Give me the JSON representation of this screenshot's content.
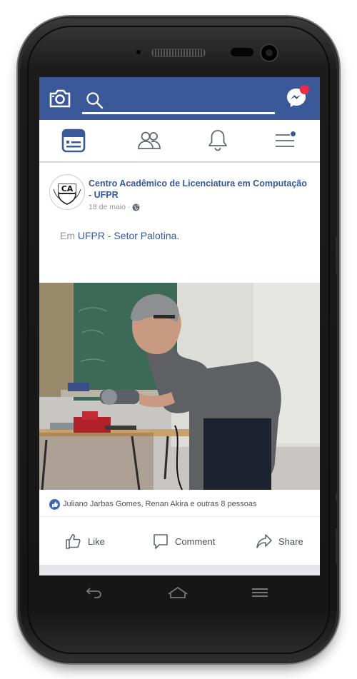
{
  "header": {
    "search_placeholder": ""
  },
  "post": {
    "page_name": "Centro Acadêmico de Licenciatura em Computação - UFPR",
    "date": "18 de maio",
    "text_prefix": "Em",
    "location": "UFPR - Setor Palotina.",
    "avatar_text": "CA",
    "likes_text": "Juliano Jarbas Gomes, Renan Akira e outras 8 pessoas"
  },
  "actions": {
    "like": "Like",
    "comment": "Comment",
    "share": "Share"
  },
  "colors": {
    "brand": "#3b5998",
    "link": "#365899",
    "badge": "#f02849"
  },
  "icons": [
    "camera-icon",
    "search-icon",
    "messenger-icon",
    "news-feed-icon",
    "friends-icon",
    "notifications-icon",
    "menu-icon",
    "globe-icon",
    "like-icon",
    "comment-icon",
    "share-icon",
    "back-icon",
    "home-icon",
    "recent-apps-icon"
  ]
}
